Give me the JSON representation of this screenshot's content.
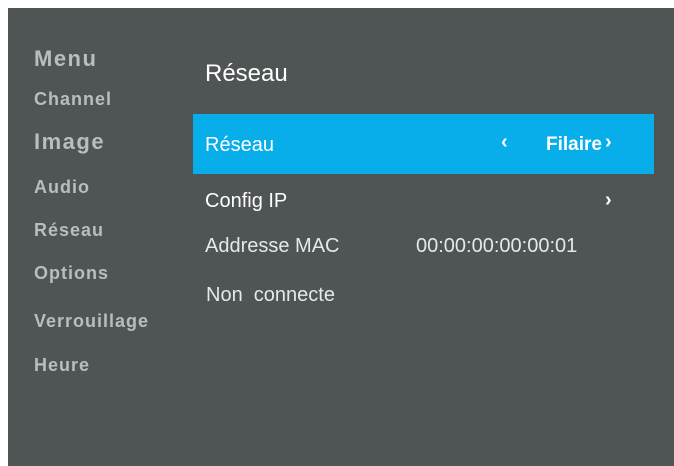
{
  "sidebar": {
    "title": "Menu",
    "items": [
      {
        "label": "Channel"
      },
      {
        "label": "Image"
      },
      {
        "label": "Audio"
      },
      {
        "label": "Réseau"
      },
      {
        "label": "Options"
      },
      {
        "label": "Verrouillage"
      },
      {
        "label": "Heure"
      }
    ]
  },
  "panel": {
    "title": "Réseau",
    "network_row": {
      "label": "Réseau",
      "value": "Filaire",
      "left_arrow": "‹",
      "right_arrow": "›"
    },
    "ip_row": {
      "label": "Config IP",
      "arrow": "›"
    },
    "mac_row": {
      "label": "Addresse MAC",
      "value": "00:00:00:00:00:01"
    },
    "status": "Non  connecte"
  },
  "colors": {
    "background": "#4f5455",
    "highlight": "#08aeea",
    "sidebar_text": "#b9bdbe",
    "text": "#ffffff"
  }
}
